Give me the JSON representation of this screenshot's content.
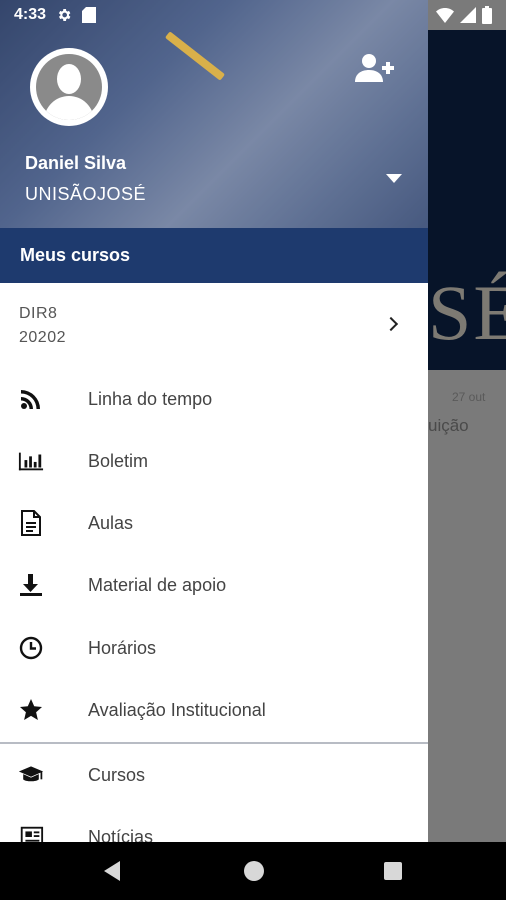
{
  "status_bar": {
    "time": "4:33",
    "icons": [
      "gear-icon",
      "sd-card-icon",
      "wifi-icon",
      "signal-icon",
      "battery-icon"
    ]
  },
  "background_app": {
    "big_text": "SÉ",
    "date": "27 out",
    "snippet": "uição"
  },
  "drawer": {
    "user": {
      "name": "Daniel Silva",
      "institution": "UNISÃOJOSÉ"
    },
    "section_title": "Meus cursos",
    "course": {
      "code": "DIR8",
      "period": "20202"
    },
    "menu": [
      {
        "label": "Linha do tempo",
        "icon": "rss-feed-icon"
      },
      {
        "label": "Boletim",
        "icon": "bar-chart-icon"
      },
      {
        "label": "Aulas",
        "icon": "document-icon"
      },
      {
        "label": "Material de apoio",
        "icon": "download-icon"
      },
      {
        "label": "Horários",
        "icon": "clock-icon"
      },
      {
        "label": "Avaliação Institucional",
        "icon": "star-icon"
      }
    ],
    "menu_secondary": [
      {
        "label": "Cursos",
        "icon": "graduation-cap-icon"
      },
      {
        "label": "Notícias",
        "icon": "newspaper-icon"
      }
    ]
  },
  "colors": {
    "header_blue": "#1e3a6e",
    "background_navy": "#071429",
    "text_gray": "#444444"
  }
}
